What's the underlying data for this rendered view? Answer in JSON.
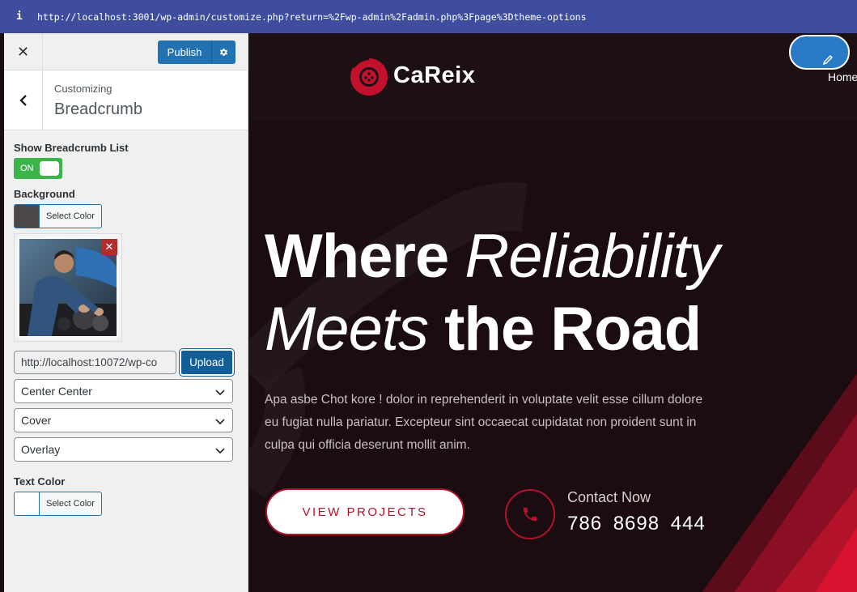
{
  "browser": {
    "url": "http://localhost:3001/wp-admin/customize.php?return=%2Fwp-admin%2Fadmin.php%3Fpage%3Dtheme-options"
  },
  "customizer": {
    "close_label": "✕",
    "publish_label": "Publish",
    "customizing_label": "Customizing",
    "section_name": "Breadcrumb",
    "show_breadcrumb_label": "Show Breadcrumb List",
    "toggle_state": "ON",
    "background_label": "Background",
    "bg_color_value": "#4a4649",
    "select_color_label": "Select Color",
    "image_url": "http://localhost:10072/wp-co",
    "upload_label": "Upload",
    "position_select": "Center Center",
    "size_select": "Cover",
    "overlay_select": "Overlay",
    "text_color_label": "Text Color",
    "text_color_value": "#ffffff"
  },
  "site": {
    "logo_text": "CaReix",
    "nav_home": "Home",
    "hero_where": "Where",
    "hero_reliability": "Reliability",
    "hero_meets": "Meets",
    "hero_road": "the Road",
    "hero_paragraph": "Apa asbe Chot kore ! dolor in reprehenderit in voluptate velit esse cillum dolore eu fugiat nulla pariatur. Excepteur sint occaecat cupidatat non proident sunt in culpa qui officia deserunt mollit anim.",
    "cta_label": "VIEW PROJECTS",
    "contact_label": "Contact Now",
    "contact_number": "786 8698 444"
  },
  "colors": {
    "brand_red": "#b3122b",
    "wp_blue": "#2271b1",
    "toggle_green": "#3bb54a"
  }
}
